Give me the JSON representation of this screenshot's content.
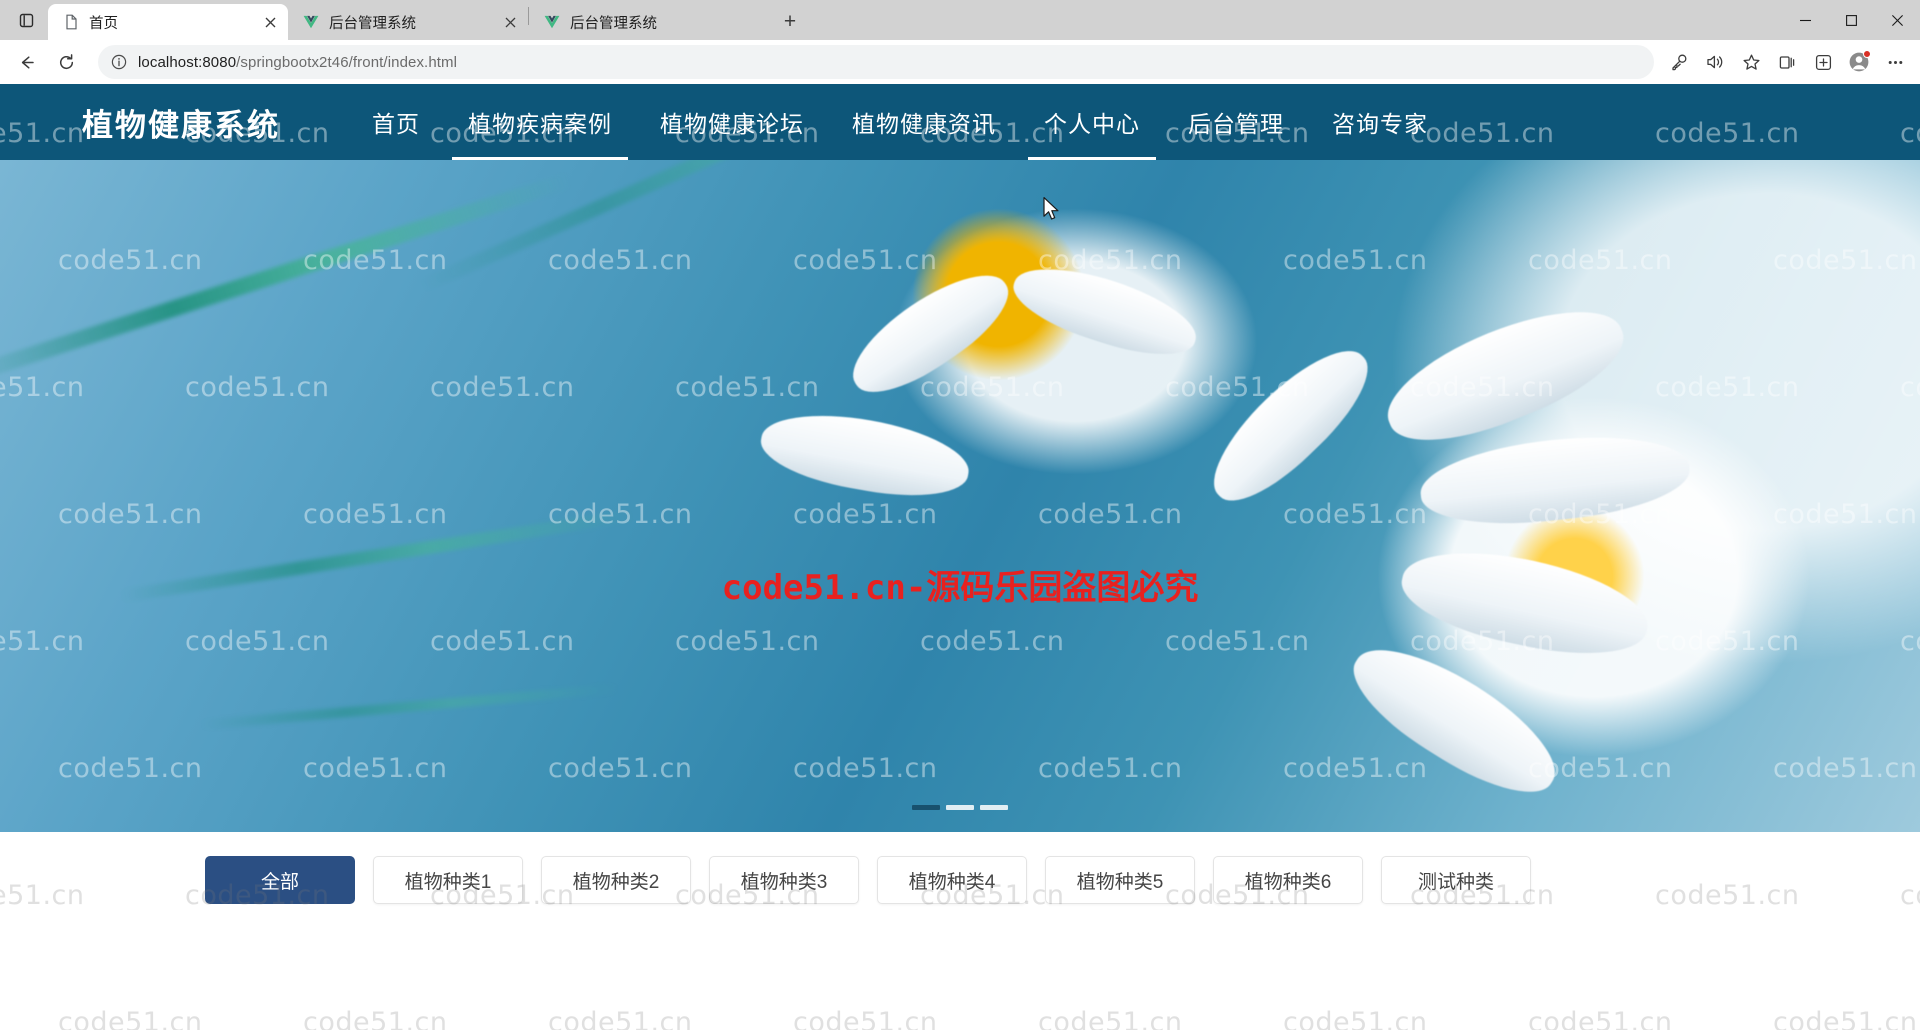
{
  "browser": {
    "tab_list_icon": "tab-list-icon",
    "tabs": [
      {
        "title": "首页",
        "favicon": "page-icon",
        "active": true,
        "has_close": true
      },
      {
        "title": "后台管理系统",
        "favicon": "vue-logo-icon",
        "active": false,
        "has_close": true
      },
      {
        "title": "后台管理系统",
        "favicon": "vue-logo-icon",
        "active": false,
        "has_close": false
      }
    ],
    "new_tab_label": "+",
    "window_controls": {
      "minimize": "—",
      "maximize": "▢",
      "close": "✕"
    },
    "toolbar": {
      "back_icon": "back-arrow-icon",
      "reload_icon": "reload-icon",
      "info_icon": "site-info-icon",
      "url_host": "localhost:8080",
      "url_path": "/springbootx2t46/front/index.html",
      "right_icons": [
        "key-icon",
        "read-aloud-icon",
        "favorite-star-icon",
        "collections-icon",
        "browser-essentials-icon",
        "profile-icon",
        "settings-more-icon"
      ]
    }
  },
  "site": {
    "brand": "植物健康系统",
    "nav": [
      {
        "label": "首页",
        "active": false
      },
      {
        "label": "植物疾病案例",
        "active": true
      },
      {
        "label": "植物健康论坛",
        "active": false
      },
      {
        "label": "植物健康资讯",
        "active": false
      },
      {
        "label": "个人中心",
        "active": true
      },
      {
        "label": "后台管理",
        "active": false
      },
      {
        "label": "咨询专家",
        "active": false
      }
    ],
    "nav_bg_color": "#0d5679"
  },
  "hero": {
    "red_watermark": "code51.cn-源码乐园盗图必究",
    "red_watermark_color": "#e8211f",
    "carousel_dots": [
      {
        "active": true
      },
      {
        "active": false
      },
      {
        "active": false
      }
    ]
  },
  "categories": {
    "items": [
      {
        "label": "全部",
        "active": true
      },
      {
        "label": "植物种类1",
        "active": false
      },
      {
        "label": "植物种类2",
        "active": false
      },
      {
        "label": "植物种类3",
        "active": false
      },
      {
        "label": "植物种类4",
        "active": false
      },
      {
        "label": "植物种类5",
        "active": false
      },
      {
        "label": "植物种类6",
        "active": false
      },
      {
        "label": "测试种类",
        "active": false
      }
    ],
    "active_color": "#2b4f83"
  },
  "watermark": {
    "text": "code51.cn"
  }
}
